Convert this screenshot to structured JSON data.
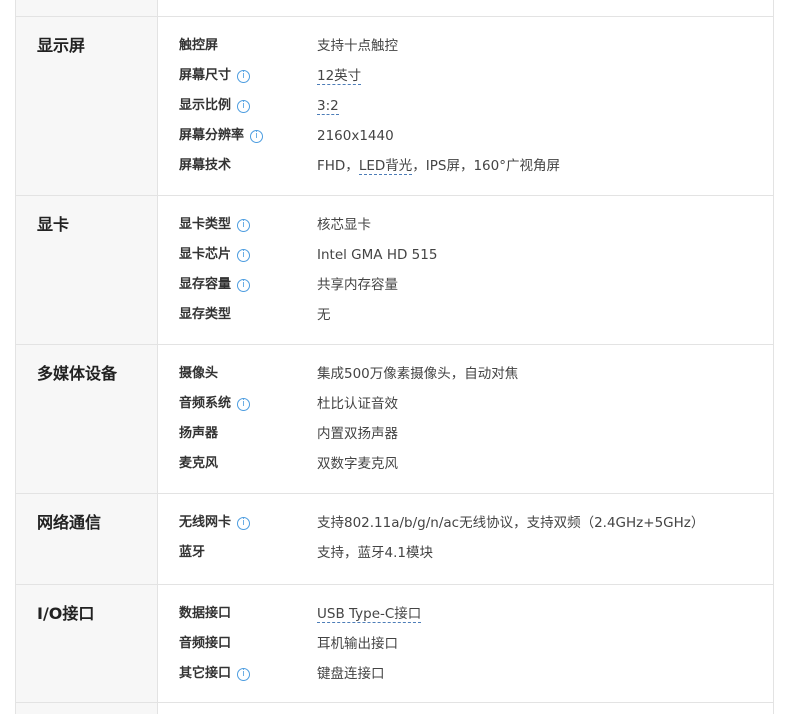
{
  "sections": [
    {
      "title": "显示屏",
      "rows": [
        {
          "label": "触控屏",
          "info": false,
          "value": "支持十点触控"
        },
        {
          "label": "屏幕尺寸",
          "info": true,
          "value": "12英寸"
        },
        {
          "label": "显示比例",
          "info": true,
          "value": "3:2"
        },
        {
          "label": "屏幕分辨率",
          "info": true,
          "value": "2160x1440"
        },
        {
          "label": "屏幕技术",
          "info": false,
          "value_pre": "FHD，",
          "value_link": "LED背光",
          "value_post": "，IPS屏，160°广视角屏"
        }
      ]
    },
    {
      "title": "显卡",
      "rows": [
        {
          "label": "显卡类型",
          "info": true,
          "value": "核芯显卡"
        },
        {
          "label": "显卡芯片",
          "info": true,
          "value": "Intel GMA HD 515"
        },
        {
          "label": "显存容量",
          "info": true,
          "value": "共享内存容量"
        },
        {
          "label": "显存类型",
          "info": false,
          "value": "无"
        }
      ]
    },
    {
      "title": "多媒体设备",
      "rows": [
        {
          "label": "摄像头",
          "info": false,
          "value": "集成500万像素摄像头，自动对焦"
        },
        {
          "label": "音频系统",
          "info": true,
          "value": "杜比认证音效"
        },
        {
          "label": "扬声器",
          "info": false,
          "value": "内置双扬声器"
        },
        {
          "label": "麦克风",
          "info": false,
          "value": "双数字麦克风"
        }
      ]
    },
    {
      "title": "网络通信",
      "rows": [
        {
          "label": "无线网卡",
          "info": true,
          "value": "支持802.11a/b/g/n/ac无线协议，支持双频（2.4GHz+5GHz）"
        },
        {
          "label": "蓝牙",
          "info": false,
          "value": "支持，蓝牙4.1模块"
        }
      ]
    },
    {
      "title": "I/O接口",
      "rows": [
        {
          "label": "数据接口",
          "info": false,
          "value": "USB Type-C接口"
        },
        {
          "label": "音频接口",
          "info": false,
          "value": "耳机输出接口"
        },
        {
          "label": "其它接口",
          "info": true,
          "value": "键盘连接口"
        }
      ]
    }
  ],
  "info_icon_glyph": "i",
  "colors": {
    "accent": "#4d9de0",
    "border": "#e3e3e3",
    "left_bg": "#f7f7f7"
  }
}
